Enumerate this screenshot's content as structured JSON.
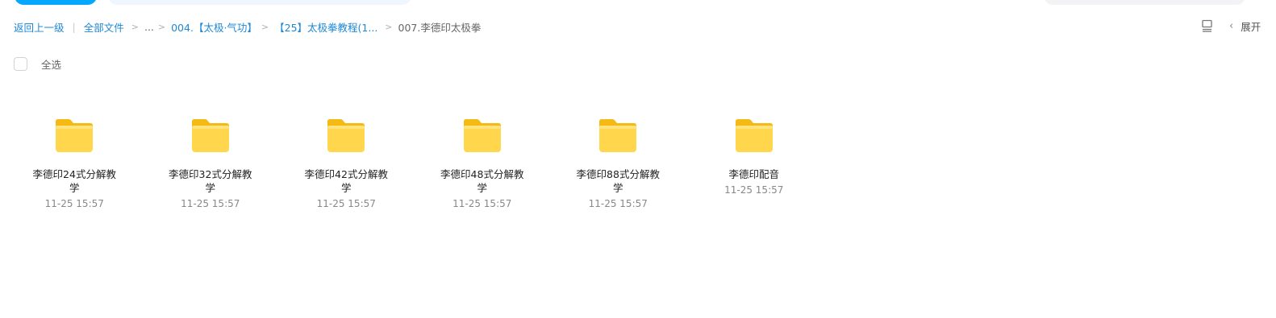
{
  "breadcrumb": {
    "back": "返回上一级",
    "divider": "|",
    "root": "全部文件",
    "sep": ">",
    "ellipsis": "...",
    "level1": "004.【太极·气功】",
    "level2": "【25】太极拳教程(1...",
    "current": "007.李德印太极拳"
  },
  "toolbar": {
    "view_icon": "list-view-icon",
    "expand_label": "展开"
  },
  "select_all_label": "全选",
  "files": [
    {
      "name": "李德印24式分解教学",
      "time": "11-25 15:57",
      "icon": "folder-icon"
    },
    {
      "name": "李德印32式分解教学",
      "time": "11-25 15:57",
      "icon": "folder-icon"
    },
    {
      "name": "李德印42式分解教学",
      "time": "11-25 15:57",
      "icon": "folder-icon"
    },
    {
      "name": "李德印48式分解教学",
      "time": "11-25 15:57",
      "icon": "folder-icon"
    },
    {
      "name": "李德印88式分解教学",
      "time": "11-25 15:57",
      "icon": "folder-icon"
    },
    {
      "name": "李德印配音",
      "time": "11-25 15:57",
      "icon": "folder-icon"
    }
  ],
  "colors": {
    "accent": "#06a7ff",
    "link": "#1e88d6",
    "folder_top": "#ffd64c",
    "folder_back": "#f5b914"
  }
}
